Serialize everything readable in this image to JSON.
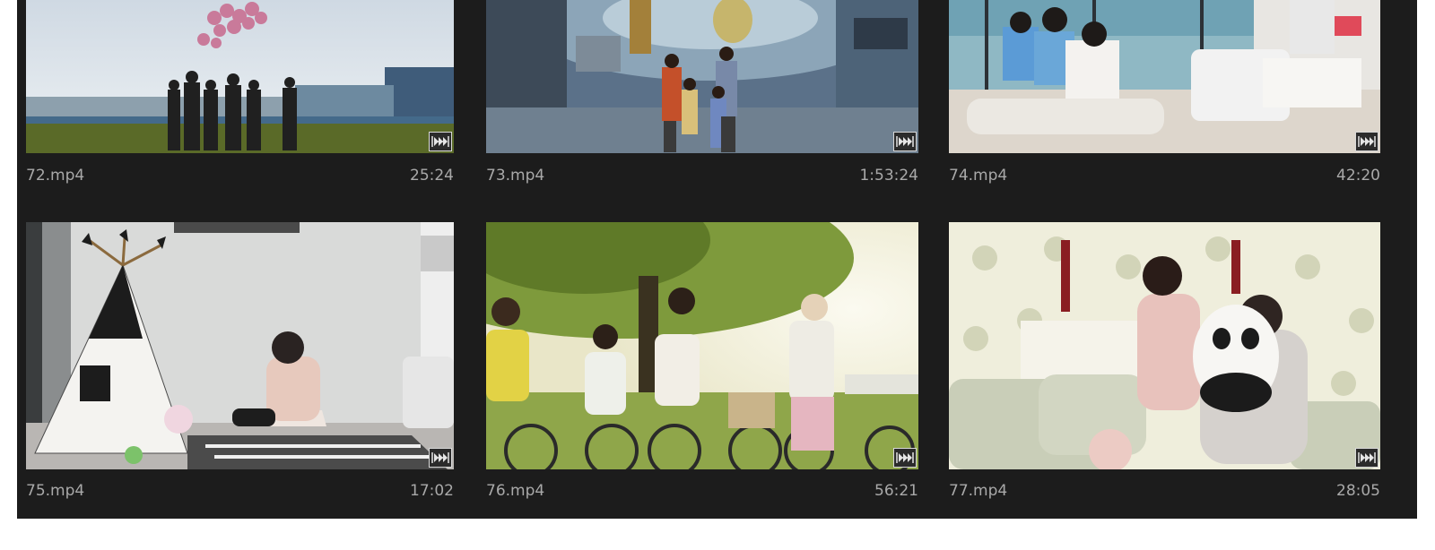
{
  "clips": [
    {
      "filename": "72.mp4",
      "duration": "25:24",
      "thumbnail": "children-releasing-balloons-on-field",
      "badge_icon": "audio-video-clip-icon"
    },
    {
      "filename": "73.mp4",
      "duration": "1:53:24",
      "thumbnail": "family-in-shopping-mall-atrium",
      "badge_icon": "audio-video-clip-icon"
    },
    {
      "filename": "74.mp4",
      "duration": "42:20",
      "thumbnail": "family-laughing-on-living-room-floor",
      "badge_icon": "audio-video-clip-icon"
    },
    {
      "filename": "75.mp4",
      "duration": "17:02",
      "thumbnail": "woman-sitting-by-play-teepee",
      "badge_icon": "audio-video-clip-icon"
    },
    {
      "filename": "76.mp4",
      "duration": "56:21",
      "thumbnail": "family-riding-bicycles-in-park",
      "badge_icon": "audio-video-clip-icon"
    },
    {
      "filename": "77.mp4",
      "duration": "28:05",
      "thumbnail": "girl-hugging-panda-toy-with-father",
      "badge_icon": "audio-video-clip-icon"
    }
  ],
  "colors": {
    "panel_bg": "#1c1c1c",
    "label_text": "#a9a9a9",
    "page_bg": "#ffffff"
  }
}
